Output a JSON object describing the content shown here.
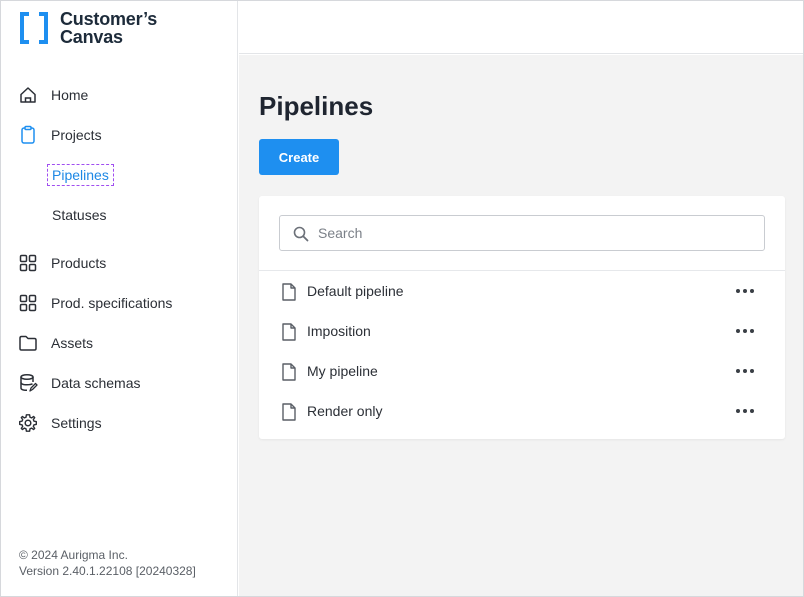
{
  "brand": {
    "name_line1": "Customer’s",
    "name_line2": "Canvas",
    "accent": "#1e8ff0"
  },
  "sidebar": {
    "items": [
      {
        "label": "Home",
        "icon": "home-icon"
      },
      {
        "label": "Projects",
        "icon": "clipboard-icon"
      },
      {
        "label": "Pipelines",
        "icon": "",
        "active": true
      },
      {
        "label": "Statuses",
        "icon": ""
      },
      {
        "label": "Products",
        "icon": "grid-icon"
      },
      {
        "label": "Prod. specifications",
        "icon": "grid-icon"
      },
      {
        "label": "Assets",
        "icon": "folder-icon"
      },
      {
        "label": "Data schemas",
        "icon": "database-edit-icon"
      },
      {
        "label": "Settings",
        "icon": "gear-icon"
      }
    ],
    "footer_copyright": "© 2024 Aurigma Inc.",
    "footer_version": "Version 2.40.1.22108 [20240328]"
  },
  "main": {
    "title": "Pipelines",
    "create_label": "Create",
    "search_placeholder": "Search",
    "search_value": "",
    "pipelines": [
      {
        "name": "Default pipeline"
      },
      {
        "name": "Imposition"
      },
      {
        "name": "My pipeline"
      },
      {
        "name": "Render only"
      }
    ]
  },
  "colors": {
    "active_link": "#1e88e5",
    "button": "#1e8ff0",
    "content_bg": "#f3f3f3"
  }
}
